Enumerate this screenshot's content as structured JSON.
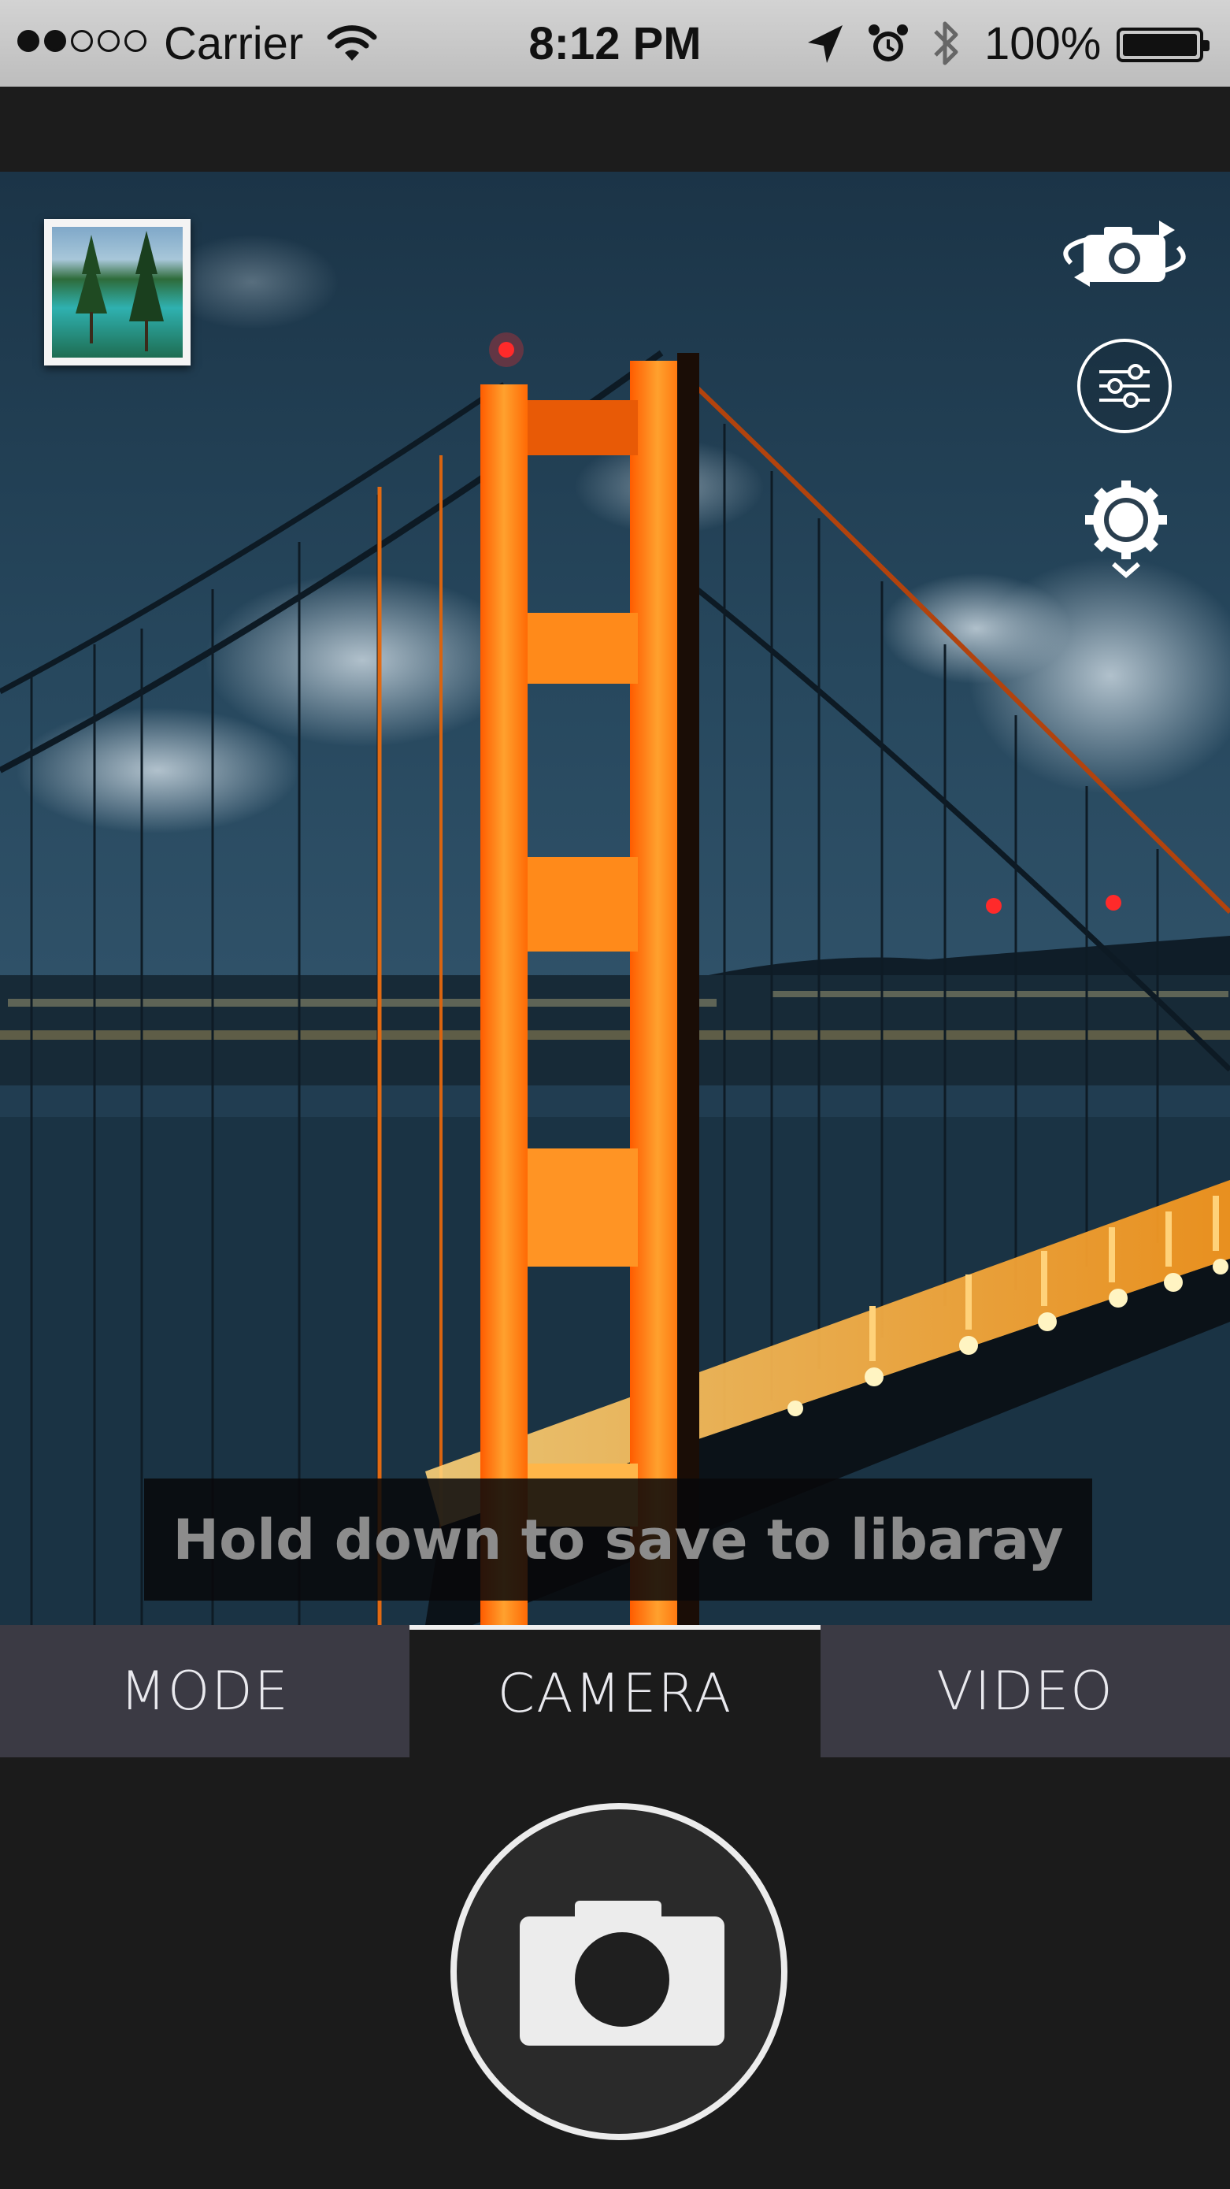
{
  "status_bar": {
    "carrier": "Carrier",
    "time": "8:12 PM",
    "battery": "100%",
    "signal_bars_filled": 2,
    "signal_bars_total": 5,
    "icons": [
      "wifi-icon",
      "location-arrow-icon",
      "alarm-clock-icon",
      "bluetooth-icon",
      "battery-icon"
    ]
  },
  "viewfinder": {
    "toast": "Hold down to save to libaray",
    "controls": [
      "switch-camera-icon",
      "settings-sliders-icon",
      "exposure-gear-icon"
    ]
  },
  "tabs": [
    {
      "label": "MODE",
      "selected": false
    },
    {
      "label": "CAMERA",
      "selected": true
    },
    {
      "label": "VIDEO",
      "selected": false
    }
  ],
  "shutter": {
    "icon": "camera-icon"
  },
  "colors": {
    "status_bar_bg": "#c8c8c8",
    "tab_bg": "#3b3a44",
    "tab_selected_bg": "#1b1b1b",
    "bridge_orange": "#ff7a12"
  }
}
